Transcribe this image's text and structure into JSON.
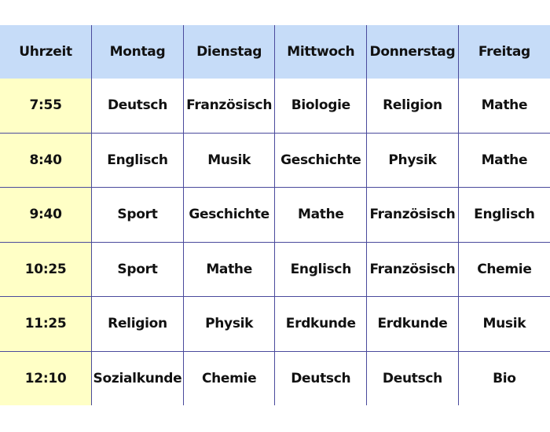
{
  "headers": [
    "Uhrzeit",
    "Montag",
    "Dienstag",
    "Mittwoch",
    "Donnerstag",
    "Freitag"
  ],
  "rows": [
    {
      "time": "7:55",
      "cells": [
        "Deutsch",
        "Französisch",
        "Biologie",
        "Religion",
        "Mathe"
      ]
    },
    {
      "time": "8:40",
      "cells": [
        "Englisch",
        "Musik",
        "Geschichte",
        "Physik",
        "Mathe"
      ]
    },
    {
      "time": "9:40",
      "cells": [
        "Sport",
        "Geschichte",
        "Mathe",
        "Französisch",
        "Englisch"
      ]
    },
    {
      "time": "10:25",
      "cells": [
        "Sport",
        "Mathe",
        "Englisch",
        "Französisch",
        "Chemie"
      ]
    },
    {
      "time": "11:25",
      "cells": [
        "Religion",
        "Physik",
        "Erdkunde",
        "Erdkunde",
        "Musik"
      ]
    },
    {
      "time": "12:10",
      "cells": [
        "Sozialkunde",
        "Chemie",
        "Deutsch",
        "Deutsch",
        "Bio"
      ]
    }
  ],
  "colors": {
    "header_bg": "#c6dcf8",
    "time_bg": "#ffffc6",
    "border": "#4a4a9c"
  }
}
